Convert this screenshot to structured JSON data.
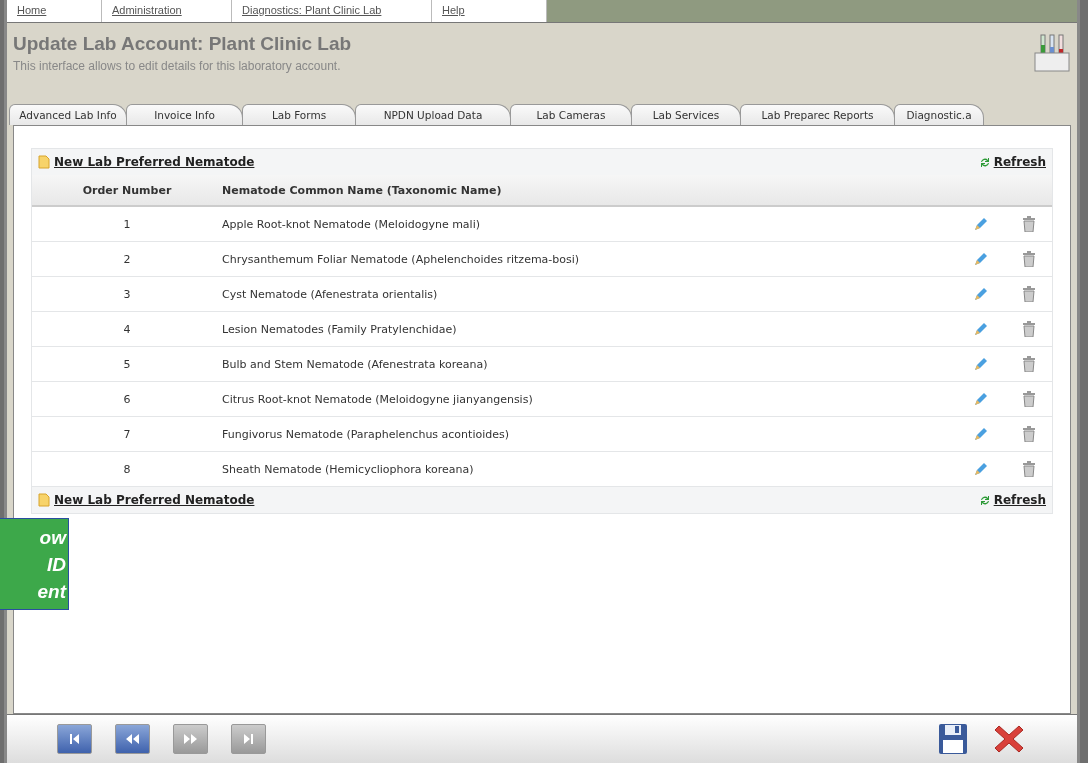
{
  "menu": [
    {
      "label": "Home"
    },
    {
      "label": "Administration"
    },
    {
      "label": "Diagnostics: Plant Clinic Lab"
    },
    {
      "label": "Help"
    }
  ],
  "header": {
    "title": "Update Lab Account: Plant Clinic Lab",
    "subtitle": "This interface allows to edit details for this laboratory account."
  },
  "tabs": [
    {
      "label": "Advanced Lab Info",
      "selected": false
    },
    {
      "label": "Invoice Info",
      "selected": false
    },
    {
      "label": "Lab Forms",
      "selected": false
    },
    {
      "label": "NPDN Upload Data",
      "selected": false
    },
    {
      "label": "Lab Cameras",
      "selected": false
    },
    {
      "label": "Lab Services",
      "selected": false
    },
    {
      "label": "Lab Preparec Reports",
      "selected": false
    },
    {
      "label": "Diagnostic.a",
      "selected": false
    }
  ],
  "toolbar_top": {
    "new_link": "New Lab Preferred Nematode",
    "refresh": "Refresh"
  },
  "table": {
    "columns": [
      "Order Number",
      "Nematode Common Name (Taxonomic Name)"
    ],
    "rows": [
      {
        "order": "1",
        "name": "Apple Root-knot Nematode (Meloidogyne mali)"
      },
      {
        "order": "2",
        "name": "Chrysanthemum Foliar Nematode (Aphelenchoides ritzema-bosi)"
      },
      {
        "order": "3",
        "name": "Cyst Nematode (Afenestrata orientalis)"
      },
      {
        "order": "4",
        "name": "Lesion Nematodes (Family Pratylenchidae)"
      },
      {
        "order": "5",
        "name": "Bulb and Stem Nematode (Afenestrata koreana)"
      },
      {
        "order": "6",
        "name": "Citrus Root-knot Nematode (Meloidogyne jianyangensis)"
      },
      {
        "order": "7",
        "name": "Fungivorus Nematode (Paraphelenchus acontioides)"
      },
      {
        "order": "8",
        "name": "Sheath Nematode (Hemicycliophora koreana)"
      }
    ]
  },
  "toolbar_bottom": {
    "new_link": "New Lab Preferred Nematode",
    "refresh": "Refresh"
  },
  "callout": {
    "lines": [
      "ow",
      "ID",
      "ent"
    ]
  },
  "footer": {
    "nav": [
      {
        "kind": "first",
        "disabled": false
      },
      {
        "kind": "prev",
        "disabled": false
      },
      {
        "kind": "next",
        "disabled": true
      },
      {
        "kind": "last",
        "disabled": true
      }
    ]
  }
}
